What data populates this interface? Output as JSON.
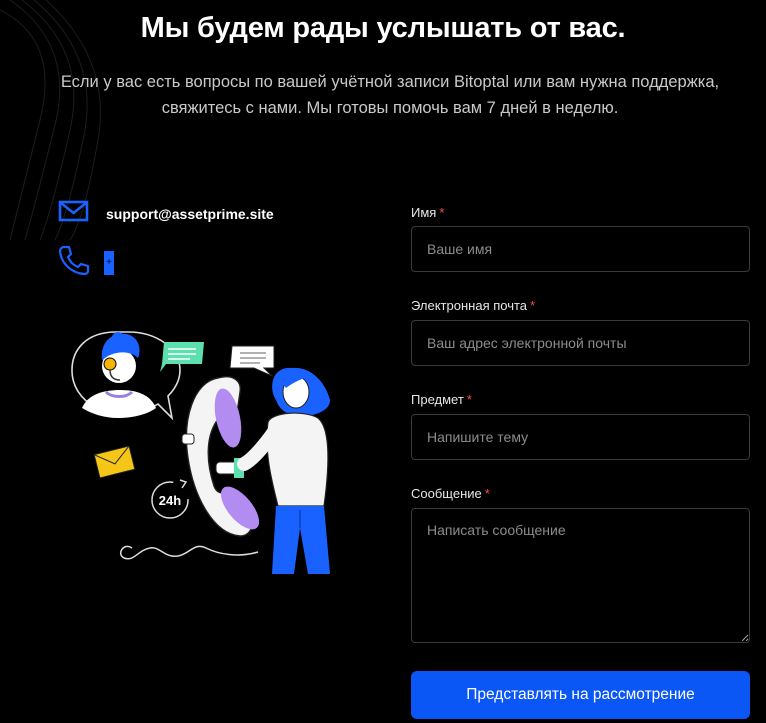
{
  "header": {
    "title": "Мы будем рады услышать от вас.",
    "subtitle": "Если у вас есть вопросы по вашей учётной записи Bitoptal или вам нужна поддержка, свяжитесь с нами. Мы готовы помочь вам 7 дней в неделю."
  },
  "contacts": {
    "email": "support@assetprime.site",
    "phone": "+",
    "email_icon": "envelope-icon",
    "phone_icon": "phone-icon"
  },
  "form": {
    "name_label": "Имя",
    "name_placeholder": "Ваше имя",
    "email_label": "Электронная почта",
    "email_placeholder": "Ваш адрес электронной почты",
    "subject_label": "Предмет",
    "subject_placeholder": "Напишите тему",
    "message_label": "Сообщение",
    "message_placeholder": "Написать сообщение",
    "required_mark": "*",
    "submit_label": "Представлять на рассмотрение"
  },
  "illustration": {
    "badge_24h": "24h"
  },
  "colors": {
    "accent": "#0b57f5",
    "icon_blue": "#1a62ff",
    "required": "#ff4d4d"
  }
}
